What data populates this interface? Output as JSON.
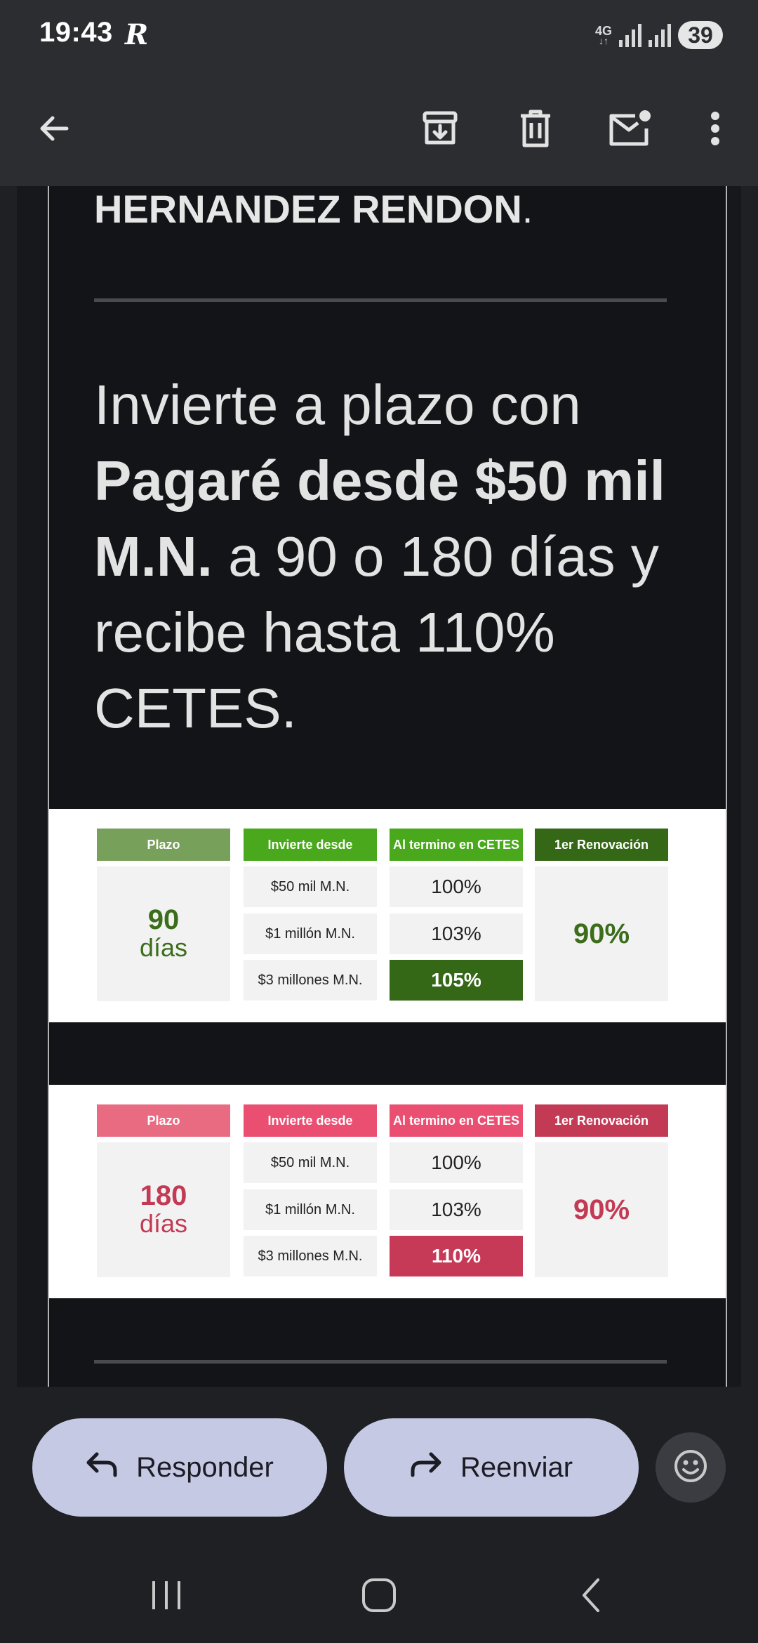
{
  "status_bar": {
    "time": "19:43",
    "carrier_glyph": "R",
    "network": "4G",
    "battery": "39"
  },
  "app_bar": {
    "icons": [
      "back-arrow-icon",
      "archive-icon",
      "trash-icon",
      "mark-unread-icon",
      "more-vert-icon"
    ]
  },
  "email": {
    "recipient_name": "HERNANDEZ RENDON",
    "recipient_punct": ".",
    "headline": {
      "part1": "Invierte a plazo con ",
      "bold": "Pagaré desde $50 mil M.N.",
      "part2": " a 90 o 180 días y recibe hasta 110% CETES."
    },
    "table_headers": {
      "plazo": "Plazo",
      "invierte": "Invierte desde",
      "cetes": "Al termino en CETES",
      "renovacion": "1er Renovación"
    },
    "tables": [
      {
        "plazo_num": "90",
        "plazo_unit": "días",
        "rows": [
          {
            "amount": "$50 mil M.N.",
            "pct": "100%"
          },
          {
            "amount": "$1 millón M.N.",
            "pct": "103%"
          },
          {
            "amount": "$3 millones M.N.",
            "pct": "105%"
          }
        ],
        "renovacion": "90%",
        "colors": {
          "plazo_head": "#77a05a",
          "invierte_head": "#49a81c",
          "cetes_head": "#49a81c",
          "renov_head": "#356816",
          "accent_text": "#3b6d1a",
          "highlight": "#356816"
        }
      },
      {
        "plazo_num": "180",
        "plazo_unit": "días",
        "rows": [
          {
            "amount": "$50 mil M.N.",
            "pct": "100%"
          },
          {
            "amount": "$1 millón M.N.",
            "pct": "103%"
          },
          {
            "amount": "$3 millones M.N.",
            "pct": "110%"
          }
        ],
        "renovacion": "90%",
        "colors": {
          "plazo_head": "#e96b82",
          "invierte_head": "#ea4f72",
          "cetes_head": "#ea4f72",
          "renov_head": "#c33a55",
          "accent_text": "#c33a55",
          "highlight": "#c63a57"
        }
      }
    ]
  },
  "actions": {
    "reply_label": "Responder",
    "forward_label": "Reenviar"
  }
}
